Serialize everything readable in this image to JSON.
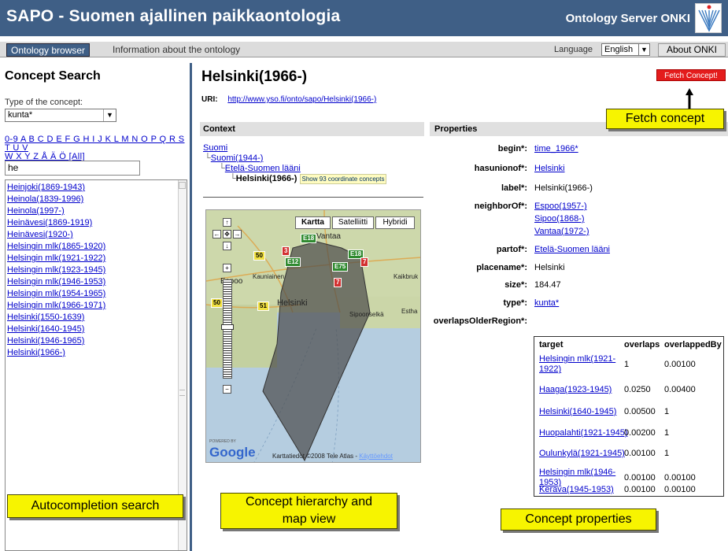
{
  "header": {
    "app_title": "SAPO - Suomen ajallinen paikkaontologia",
    "server_title": "Ontology Server ONKI"
  },
  "nav": {
    "tab_browser": "Ontology browser",
    "tab_info": "Information about the ontology",
    "language_label": "Language",
    "language_value": "English",
    "about_label": "About ONKI"
  },
  "search": {
    "title": "Concept Search",
    "type_label": "Type of the concept:",
    "type_value": "kunta*",
    "alphabet_line1": "0-9 A B C D E F G H I J K L M N O P Q R S T U V",
    "alphabet_line2": "W X Y Z Å Ä Ö [All]",
    "input_value": "he",
    "results": [
      "Heinjoki(1869-1943)",
      "Heinola(1839-1996)",
      "Heinola(1997-)",
      "Heinävesi(1869-1919)",
      "Heinävesi(1920-)",
      "Helsingin mlk(1865-1920)",
      "Helsingin mlk(1921-1922)",
      "Helsingin mlk(1923-1945)",
      "Helsingin mlk(1946-1953)",
      "Helsingin mlk(1954-1965)",
      "Helsingin mlk(1966-1971)",
      "Helsinki(1550-1639)",
      "Helsinki(1640-1945)",
      "Helsinki(1946-1965)",
      "Helsinki(1966-)"
    ]
  },
  "concept": {
    "title": "Helsinki(1966-)",
    "fetch_label": "Fetch Concept!",
    "uri_label": "URI:",
    "uri": "http://www.yso.fi/onto/sapo/Helsinki(1966-)"
  },
  "context": {
    "heading": "Context",
    "tree": [
      {
        "label": "Suomi"
      },
      {
        "label": "Suomi(1944-)",
        "prefix": "└"
      },
      {
        "label": "Etelä-Suomen lääni",
        "prefix": "└"
      },
      {
        "label": "Helsinki(1966-)",
        "prefix": "└"
      }
    ],
    "coordinate_badge": "Show 93 coordinate concepts"
  },
  "map": {
    "btn_kartta": "Kartta",
    "btn_satellite": "Satelliitti",
    "btn_hybrid": "Hybridi",
    "labels": {
      "vantaa": "Vantaa",
      "espoo": "Espoo",
      "helsinki": "Helsinki",
      "kauniainen": "Kauniainen",
      "sipoonselka": "Sipoonselkä",
      "kaikbruk": "Kaikbruk",
      "estha": "Estha"
    },
    "roads": [
      "E18",
      "E18",
      "50",
      "51",
      "E75",
      "50",
      "7",
      "3",
      "E12",
      "7"
    ],
    "google": "Google",
    "powered_by": "POWERED BY",
    "copyright": "Karttatiedot ©2008 Tele Atlas - ",
    "terms": "Käyttöehdot"
  },
  "properties": {
    "heading": "Properties",
    "rows": [
      {
        "name": "begin*:",
        "values": [
          "time_1966*"
        ],
        "link": true
      },
      {
        "name": "hasunionof*:",
        "values": [
          "Helsinki"
        ],
        "link": true
      },
      {
        "name": "label*:",
        "values": [
          "Helsinki(1966-)"
        ],
        "link": false
      },
      {
        "name": "neighborOf*:",
        "values": [
          "Espoo(1957-)",
          "Sipoo(1868-)",
          "Vantaa(1972-)"
        ],
        "link": true
      },
      {
        "name": "partof*:",
        "values": [
          "Etelä-Suomen lääni"
        ],
        "link": true
      },
      {
        "name": "placename*:",
        "values": [
          "Helsinki"
        ],
        "link": false
      },
      {
        "name": "size*:",
        "values": [
          "184.47"
        ],
        "link": false
      },
      {
        "name": "type*:",
        "values": [
          "kunta*"
        ],
        "link": true
      }
    ],
    "overlaps_name": "overlapsOlderRegion*:",
    "overlap_headers": [
      "target",
      "overlaps",
      "overlappedBy"
    ],
    "overlaps": [
      {
        "target": "Helsingin mlk(1921-1922)",
        "overlaps": "1",
        "overlappedBy": "0.00100"
      },
      {
        "target": "Haaga(1923-1945)",
        "overlaps": "0.0250",
        "overlappedBy": "0.00400"
      },
      {
        "target": "Helsinki(1640-1945)",
        "overlaps": "0.00500",
        "overlappedBy": "1"
      },
      {
        "target": "Huopalahti(1921-1945)",
        "overlaps": "0.00200",
        "overlappedBy": "1"
      },
      {
        "target": "Oulunkylä(1921-1945)",
        "overlaps": "0.00100",
        "overlappedBy": "1"
      },
      {
        "target": "Helsingin mlk(1946-1953)",
        "overlaps": "0.00100",
        "overlappedBy": "0.00100"
      },
      {
        "target": "Kerava(1945-1953)",
        "overlaps": "0.00100",
        "overlappedBy": "0.00100"
      }
    ]
  },
  "annotations": {
    "fetch": "Fetch concept",
    "autocomplete": "Autocompletion search",
    "hierarchy_line1": "Concept hierarchy and",
    "hierarchy_line2": "map view",
    "properties": "Concept properties"
  },
  "colors": {
    "header_bg": "#3f5f86",
    "fetch_button": "#e41c1c",
    "callout": "#f7f400",
    "link": "#0000cc"
  }
}
